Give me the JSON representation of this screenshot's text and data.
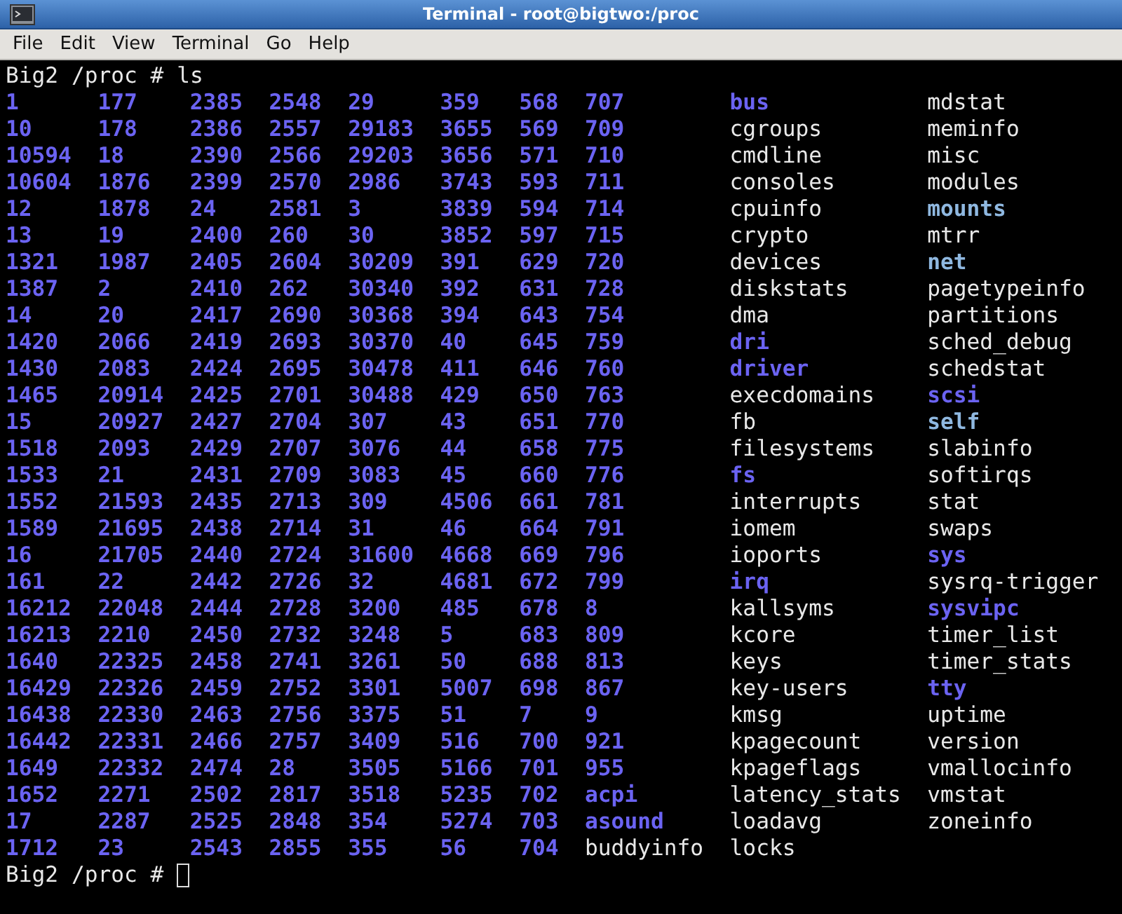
{
  "window": {
    "title": "Terminal - root@bigtwo:/proc"
  },
  "menu": [
    "File",
    "Edit",
    "View",
    "Terminal",
    "Go",
    "Help"
  ],
  "terminal": {
    "command_line": {
      "prompt": "Big2 /proc #",
      "command": "ls"
    },
    "listing": [
      [
        {
          "name": "1",
          "kind": "dir"
        },
        {
          "name": "10",
          "kind": "dir"
        },
        {
          "name": "10594",
          "kind": "dir"
        },
        {
          "name": "10604",
          "kind": "dir"
        },
        {
          "name": "12",
          "kind": "dir"
        },
        {
          "name": "13",
          "kind": "dir"
        },
        {
          "name": "1321",
          "kind": "dir"
        },
        {
          "name": "1387",
          "kind": "dir"
        },
        {
          "name": "14",
          "kind": "dir"
        },
        {
          "name": "1420",
          "kind": "dir"
        },
        {
          "name": "1430",
          "kind": "dir"
        },
        {
          "name": "1465",
          "kind": "dir"
        },
        {
          "name": "15",
          "kind": "dir"
        },
        {
          "name": "1518",
          "kind": "dir"
        },
        {
          "name": "1533",
          "kind": "dir"
        },
        {
          "name": "1552",
          "kind": "dir"
        },
        {
          "name": "1589",
          "kind": "dir"
        },
        {
          "name": "16",
          "kind": "dir"
        },
        {
          "name": "161",
          "kind": "dir"
        },
        {
          "name": "16212",
          "kind": "dir"
        },
        {
          "name": "16213",
          "kind": "dir"
        },
        {
          "name": "1640",
          "kind": "dir"
        },
        {
          "name": "16429",
          "kind": "dir"
        },
        {
          "name": "16438",
          "kind": "dir"
        },
        {
          "name": "16442",
          "kind": "dir"
        },
        {
          "name": "1649",
          "kind": "dir"
        },
        {
          "name": "1652",
          "kind": "dir"
        },
        {
          "name": "17",
          "kind": "dir"
        },
        {
          "name": "1712",
          "kind": "dir"
        }
      ],
      [
        {
          "name": "177",
          "kind": "dir"
        },
        {
          "name": "178",
          "kind": "dir"
        },
        {
          "name": "18",
          "kind": "dir"
        },
        {
          "name": "1876",
          "kind": "dir"
        },
        {
          "name": "1878",
          "kind": "dir"
        },
        {
          "name": "19",
          "kind": "dir"
        },
        {
          "name": "1987",
          "kind": "dir"
        },
        {
          "name": "2",
          "kind": "dir"
        },
        {
          "name": "20",
          "kind": "dir"
        },
        {
          "name": "2066",
          "kind": "dir"
        },
        {
          "name": "2083",
          "kind": "dir"
        },
        {
          "name": "20914",
          "kind": "dir"
        },
        {
          "name": "20927",
          "kind": "dir"
        },
        {
          "name": "2093",
          "kind": "dir"
        },
        {
          "name": "21",
          "kind": "dir"
        },
        {
          "name": "21593",
          "kind": "dir"
        },
        {
          "name": "21695",
          "kind": "dir"
        },
        {
          "name": "21705",
          "kind": "dir"
        },
        {
          "name": "22",
          "kind": "dir"
        },
        {
          "name": "22048",
          "kind": "dir"
        },
        {
          "name": "2210",
          "kind": "dir"
        },
        {
          "name": "22325",
          "kind": "dir"
        },
        {
          "name": "22326",
          "kind": "dir"
        },
        {
          "name": "22330",
          "kind": "dir"
        },
        {
          "name": "22331",
          "kind": "dir"
        },
        {
          "name": "22332",
          "kind": "dir"
        },
        {
          "name": "2271",
          "kind": "dir"
        },
        {
          "name": "2287",
          "kind": "dir"
        },
        {
          "name": "23",
          "kind": "dir"
        }
      ],
      [
        {
          "name": "2385",
          "kind": "dir"
        },
        {
          "name": "2386",
          "kind": "dir"
        },
        {
          "name": "2390",
          "kind": "dir"
        },
        {
          "name": "2399",
          "kind": "dir"
        },
        {
          "name": "24",
          "kind": "dir"
        },
        {
          "name": "2400",
          "kind": "dir"
        },
        {
          "name": "2405",
          "kind": "dir"
        },
        {
          "name": "2410",
          "kind": "dir"
        },
        {
          "name": "2417",
          "kind": "dir"
        },
        {
          "name": "2419",
          "kind": "dir"
        },
        {
          "name": "2424",
          "kind": "dir"
        },
        {
          "name": "2425",
          "kind": "dir"
        },
        {
          "name": "2427",
          "kind": "dir"
        },
        {
          "name": "2429",
          "kind": "dir"
        },
        {
          "name": "2431",
          "kind": "dir"
        },
        {
          "name": "2435",
          "kind": "dir"
        },
        {
          "name": "2438",
          "kind": "dir"
        },
        {
          "name": "2440",
          "kind": "dir"
        },
        {
          "name": "2442",
          "kind": "dir"
        },
        {
          "name": "2444",
          "kind": "dir"
        },
        {
          "name": "2450",
          "kind": "dir"
        },
        {
          "name": "2458",
          "kind": "dir"
        },
        {
          "name": "2459",
          "kind": "dir"
        },
        {
          "name": "2463",
          "kind": "dir"
        },
        {
          "name": "2466",
          "kind": "dir"
        },
        {
          "name": "2474",
          "kind": "dir"
        },
        {
          "name": "2502",
          "kind": "dir"
        },
        {
          "name": "2525",
          "kind": "dir"
        },
        {
          "name": "2543",
          "kind": "dir"
        }
      ],
      [
        {
          "name": "2548",
          "kind": "dir"
        },
        {
          "name": "2557",
          "kind": "dir"
        },
        {
          "name": "2566",
          "kind": "dir"
        },
        {
          "name": "2570",
          "kind": "dir"
        },
        {
          "name": "2581",
          "kind": "dir"
        },
        {
          "name": "260",
          "kind": "dir"
        },
        {
          "name": "2604",
          "kind": "dir"
        },
        {
          "name": "262",
          "kind": "dir"
        },
        {
          "name": "2690",
          "kind": "dir"
        },
        {
          "name": "2693",
          "kind": "dir"
        },
        {
          "name": "2695",
          "kind": "dir"
        },
        {
          "name": "2701",
          "kind": "dir"
        },
        {
          "name": "2704",
          "kind": "dir"
        },
        {
          "name": "2707",
          "kind": "dir"
        },
        {
          "name": "2709",
          "kind": "dir"
        },
        {
          "name": "2713",
          "kind": "dir"
        },
        {
          "name": "2714",
          "kind": "dir"
        },
        {
          "name": "2724",
          "kind": "dir"
        },
        {
          "name": "2726",
          "kind": "dir"
        },
        {
          "name": "2728",
          "kind": "dir"
        },
        {
          "name": "2732",
          "kind": "dir"
        },
        {
          "name": "2741",
          "kind": "dir"
        },
        {
          "name": "2752",
          "kind": "dir"
        },
        {
          "name": "2756",
          "kind": "dir"
        },
        {
          "name": "2757",
          "kind": "dir"
        },
        {
          "name": "28",
          "kind": "dir"
        },
        {
          "name": "2817",
          "kind": "dir"
        },
        {
          "name": "2848",
          "kind": "dir"
        },
        {
          "name": "2855",
          "kind": "dir"
        }
      ],
      [
        {
          "name": "29",
          "kind": "dir"
        },
        {
          "name": "29183",
          "kind": "dir"
        },
        {
          "name": "29203",
          "kind": "dir"
        },
        {
          "name": "2986",
          "kind": "dir"
        },
        {
          "name": "3",
          "kind": "dir"
        },
        {
          "name": "30",
          "kind": "dir"
        },
        {
          "name": "30209",
          "kind": "dir"
        },
        {
          "name": "30340",
          "kind": "dir"
        },
        {
          "name": "30368",
          "kind": "dir"
        },
        {
          "name": "30370",
          "kind": "dir"
        },
        {
          "name": "30478",
          "kind": "dir"
        },
        {
          "name": "30488",
          "kind": "dir"
        },
        {
          "name": "307",
          "kind": "dir"
        },
        {
          "name": "3076",
          "kind": "dir"
        },
        {
          "name": "3083",
          "kind": "dir"
        },
        {
          "name": "309",
          "kind": "dir"
        },
        {
          "name": "31",
          "kind": "dir"
        },
        {
          "name": "31600",
          "kind": "dir"
        },
        {
          "name": "32",
          "kind": "dir"
        },
        {
          "name": "3200",
          "kind": "dir"
        },
        {
          "name": "3248",
          "kind": "dir"
        },
        {
          "name": "3261",
          "kind": "dir"
        },
        {
          "name": "3301",
          "kind": "dir"
        },
        {
          "name": "3375",
          "kind": "dir"
        },
        {
          "name": "3409",
          "kind": "dir"
        },
        {
          "name": "3505",
          "kind": "dir"
        },
        {
          "name": "3518",
          "kind": "dir"
        },
        {
          "name": "354",
          "kind": "dir"
        },
        {
          "name": "355",
          "kind": "dir"
        }
      ],
      [
        {
          "name": "359",
          "kind": "dir"
        },
        {
          "name": "3655",
          "kind": "dir"
        },
        {
          "name": "3656",
          "kind": "dir"
        },
        {
          "name": "3743",
          "kind": "dir"
        },
        {
          "name": "3839",
          "kind": "dir"
        },
        {
          "name": "3852",
          "kind": "dir"
        },
        {
          "name": "391",
          "kind": "dir"
        },
        {
          "name": "392",
          "kind": "dir"
        },
        {
          "name": "394",
          "kind": "dir"
        },
        {
          "name": "40",
          "kind": "dir"
        },
        {
          "name": "411",
          "kind": "dir"
        },
        {
          "name": "429",
          "kind": "dir"
        },
        {
          "name": "43",
          "kind": "dir"
        },
        {
          "name": "44",
          "kind": "dir"
        },
        {
          "name": "45",
          "kind": "dir"
        },
        {
          "name": "4506",
          "kind": "dir"
        },
        {
          "name": "46",
          "kind": "dir"
        },
        {
          "name": "4668",
          "kind": "dir"
        },
        {
          "name": "4681",
          "kind": "dir"
        },
        {
          "name": "485",
          "kind": "dir"
        },
        {
          "name": "5",
          "kind": "dir"
        },
        {
          "name": "50",
          "kind": "dir"
        },
        {
          "name": "5007",
          "kind": "dir"
        },
        {
          "name": "51",
          "kind": "dir"
        },
        {
          "name": "516",
          "kind": "dir"
        },
        {
          "name": "5166",
          "kind": "dir"
        },
        {
          "name": "5235",
          "kind": "dir"
        },
        {
          "name": "5274",
          "kind": "dir"
        },
        {
          "name": "56",
          "kind": "dir"
        }
      ],
      [
        {
          "name": "568",
          "kind": "dir"
        },
        {
          "name": "569",
          "kind": "dir"
        },
        {
          "name": "571",
          "kind": "dir"
        },
        {
          "name": "593",
          "kind": "dir"
        },
        {
          "name": "594",
          "kind": "dir"
        },
        {
          "name": "597",
          "kind": "dir"
        },
        {
          "name": "629",
          "kind": "dir"
        },
        {
          "name": "631",
          "kind": "dir"
        },
        {
          "name": "643",
          "kind": "dir"
        },
        {
          "name": "645",
          "kind": "dir"
        },
        {
          "name": "646",
          "kind": "dir"
        },
        {
          "name": "650",
          "kind": "dir"
        },
        {
          "name": "651",
          "kind": "dir"
        },
        {
          "name": "658",
          "kind": "dir"
        },
        {
          "name": "660",
          "kind": "dir"
        },
        {
          "name": "661",
          "kind": "dir"
        },
        {
          "name": "664",
          "kind": "dir"
        },
        {
          "name": "669",
          "kind": "dir"
        },
        {
          "name": "672",
          "kind": "dir"
        },
        {
          "name": "678",
          "kind": "dir"
        },
        {
          "name": "683",
          "kind": "dir"
        },
        {
          "name": "688",
          "kind": "dir"
        },
        {
          "name": "698",
          "kind": "dir"
        },
        {
          "name": "7",
          "kind": "dir"
        },
        {
          "name": "700",
          "kind": "dir"
        },
        {
          "name": "701",
          "kind": "dir"
        },
        {
          "name": "702",
          "kind": "dir"
        },
        {
          "name": "703",
          "kind": "dir"
        },
        {
          "name": "704",
          "kind": "dir"
        }
      ],
      [
        {
          "name": "707",
          "kind": "dir"
        },
        {
          "name": "709",
          "kind": "dir"
        },
        {
          "name": "710",
          "kind": "dir"
        },
        {
          "name": "711",
          "kind": "dir"
        },
        {
          "name": "714",
          "kind": "dir"
        },
        {
          "name": "715",
          "kind": "dir"
        },
        {
          "name": "720",
          "kind": "dir"
        },
        {
          "name": "728",
          "kind": "dir"
        },
        {
          "name": "754",
          "kind": "dir"
        },
        {
          "name": "759",
          "kind": "dir"
        },
        {
          "name": "760",
          "kind": "dir"
        },
        {
          "name": "763",
          "kind": "dir"
        },
        {
          "name": "770",
          "kind": "dir"
        },
        {
          "name": "775",
          "kind": "dir"
        },
        {
          "name": "776",
          "kind": "dir"
        },
        {
          "name": "781",
          "kind": "dir"
        },
        {
          "name": "791",
          "kind": "dir"
        },
        {
          "name": "796",
          "kind": "dir"
        },
        {
          "name": "799",
          "kind": "dir"
        },
        {
          "name": "8",
          "kind": "dir"
        },
        {
          "name": "809",
          "kind": "dir"
        },
        {
          "name": "813",
          "kind": "dir"
        },
        {
          "name": "867",
          "kind": "dir"
        },
        {
          "name": "9",
          "kind": "dir"
        },
        {
          "name": "921",
          "kind": "dir"
        },
        {
          "name": "955",
          "kind": "dir"
        },
        {
          "name": "acpi",
          "kind": "dir"
        },
        {
          "name": "asound",
          "kind": "dir"
        },
        {
          "name": "buddyinfo",
          "kind": "file"
        }
      ],
      [
        {
          "name": "bus",
          "kind": "dir"
        },
        {
          "name": "cgroups",
          "kind": "file"
        },
        {
          "name": "cmdline",
          "kind": "file"
        },
        {
          "name": "consoles",
          "kind": "file"
        },
        {
          "name": "cpuinfo",
          "kind": "file"
        },
        {
          "name": "crypto",
          "kind": "file"
        },
        {
          "name": "devices",
          "kind": "file"
        },
        {
          "name": "diskstats",
          "kind": "file"
        },
        {
          "name": "dma",
          "kind": "file"
        },
        {
          "name": "dri",
          "kind": "dir"
        },
        {
          "name": "driver",
          "kind": "dir"
        },
        {
          "name": "execdomains",
          "kind": "file"
        },
        {
          "name": "fb",
          "kind": "file"
        },
        {
          "name": "filesystems",
          "kind": "file"
        },
        {
          "name": "fs",
          "kind": "dir"
        },
        {
          "name": "interrupts",
          "kind": "file"
        },
        {
          "name": "iomem",
          "kind": "file"
        },
        {
          "name": "ioports",
          "kind": "file"
        },
        {
          "name": "irq",
          "kind": "dir"
        },
        {
          "name": "kallsyms",
          "kind": "file"
        },
        {
          "name": "kcore",
          "kind": "file"
        },
        {
          "name": "keys",
          "kind": "file"
        },
        {
          "name": "key-users",
          "kind": "file"
        },
        {
          "name": "kmsg",
          "kind": "file"
        },
        {
          "name": "kpagecount",
          "kind": "file"
        },
        {
          "name": "kpageflags",
          "kind": "file"
        },
        {
          "name": "latency_stats",
          "kind": "file"
        },
        {
          "name": "loadavg",
          "kind": "file"
        },
        {
          "name": "locks",
          "kind": "file"
        }
      ],
      [
        {
          "name": "mdstat",
          "kind": "file"
        },
        {
          "name": "meminfo",
          "kind": "file"
        },
        {
          "name": "misc",
          "kind": "file"
        },
        {
          "name": "modules",
          "kind": "file"
        },
        {
          "name": "mounts",
          "kind": "link"
        },
        {
          "name": "mtrr",
          "kind": "file"
        },
        {
          "name": "net",
          "kind": "link"
        },
        {
          "name": "pagetypeinfo",
          "kind": "file"
        },
        {
          "name": "partitions",
          "kind": "file"
        },
        {
          "name": "sched_debug",
          "kind": "file"
        },
        {
          "name": "schedstat",
          "kind": "file"
        },
        {
          "name": "scsi",
          "kind": "dir"
        },
        {
          "name": "self",
          "kind": "link"
        },
        {
          "name": "slabinfo",
          "kind": "file"
        },
        {
          "name": "softirqs",
          "kind": "file"
        },
        {
          "name": "stat",
          "kind": "file"
        },
        {
          "name": "swaps",
          "kind": "file"
        },
        {
          "name": "sys",
          "kind": "dir"
        },
        {
          "name": "sysrq-trigger",
          "kind": "file"
        },
        {
          "name": "sysvipc",
          "kind": "dir"
        },
        {
          "name": "timer_list",
          "kind": "file"
        },
        {
          "name": "timer_stats",
          "kind": "file"
        },
        {
          "name": "tty",
          "kind": "dir"
        },
        {
          "name": "uptime",
          "kind": "file"
        },
        {
          "name": "version",
          "kind": "file"
        },
        {
          "name": "vmallocinfo",
          "kind": "file"
        },
        {
          "name": "vmstat",
          "kind": "file"
        },
        {
          "name": "zoneinfo",
          "kind": "file"
        }
      ]
    ],
    "prompt_line": {
      "prompt": "Big2 /proc #"
    }
  }
}
